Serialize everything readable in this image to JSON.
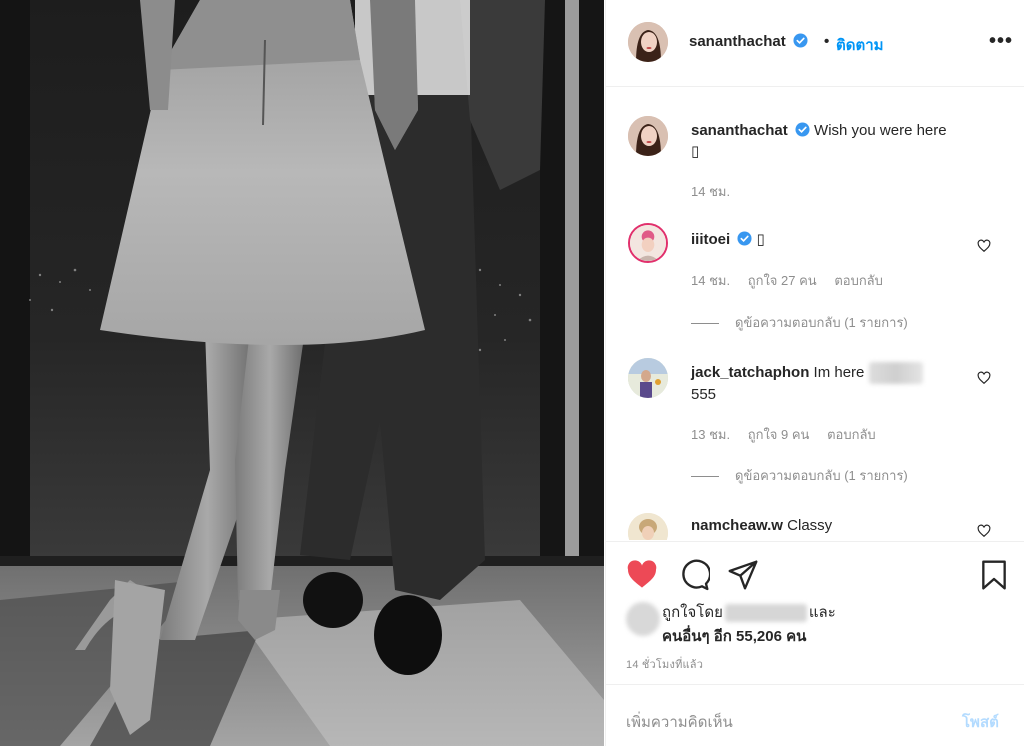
{
  "post": {
    "username": "sananthachat",
    "separator": "•",
    "follow_label": "ติดตาม",
    "more_label": "•••"
  },
  "caption": {
    "username": "sananthachat",
    "text": "Wish you were here",
    "emoji": "▯",
    "time": "14 ชม."
  },
  "comments": [
    {
      "username": "iiitoei",
      "text": "▯",
      "time": "14 ชม.",
      "likes": "ถูกใจ 27 คน",
      "reply_label": "ตอบกลับ",
      "view_replies": "ดูข้อความตอบกลับ (1 รายการ)"
    },
    {
      "username": "jack_tatchaphon",
      "text": "Im here",
      "text2": "555",
      "time": "13 ชม.",
      "likes": "ถูกใจ 9 คน",
      "reply_label": "ตอบกลับ",
      "view_replies": "ดูข้อความตอบกลับ (1 รายการ)"
    },
    {
      "username": "namcheaw.w",
      "text": "Classy"
    }
  ],
  "likes": {
    "liked_by_prefix": "ถูกใจโดย",
    "liked_by_suffix": "และ",
    "others": "คนอื่นๆ อีก 55,206 คน"
  },
  "timestamp": "14 ชั่วโมงที่แล้ว",
  "comment_box": {
    "placeholder": "เพิ่มความคิดเห็น",
    "post_label": "โพสต์"
  },
  "colors": {
    "accent": "#0095f6",
    "like_red": "#ed4956",
    "muted": "#8e8e8e",
    "post_disabled": "#b3dbff"
  },
  "icons": [
    "heart-filled-icon",
    "comment-icon",
    "share-icon",
    "bookmark-icon",
    "verified-icon",
    "small-heart-icon"
  ]
}
